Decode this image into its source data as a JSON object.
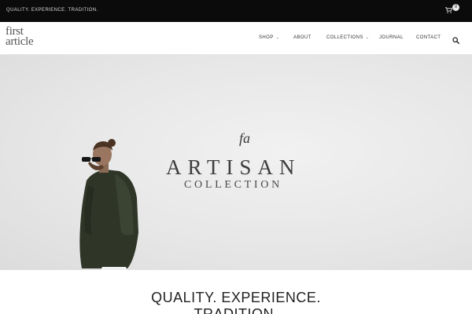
{
  "topbar": {
    "tagline": "QUALITY. EXPERIENCE. TRADITION.",
    "cart_icon": "shopping-cart-icon",
    "cart_count": "0"
  },
  "header": {
    "logo_line1": "first",
    "logo_line2": "article",
    "nav": [
      {
        "label": "SHOP",
        "has_dropdown": true
      },
      {
        "label": "ABOUT",
        "has_dropdown": false
      },
      {
        "label": "COLLECTIONS",
        "has_dropdown": true
      },
      {
        "label": "JOURNAL",
        "has_dropdown": false
      },
      {
        "label": "CONTACT",
        "has_dropdown": false
      }
    ],
    "search_icon": "search-icon"
  },
  "hero": {
    "monogram": "fa",
    "title": "ARTISAN",
    "subtitle": "COLLECTION"
  },
  "section": {
    "heading_line1": "QUALITY. EXPERIENCE.",
    "heading_line2": "TRADITION."
  },
  "colors": {
    "topbar_bg": "#0b0b0b",
    "hero_bg": "#e9e9e9",
    "text_dark": "#222222"
  }
}
